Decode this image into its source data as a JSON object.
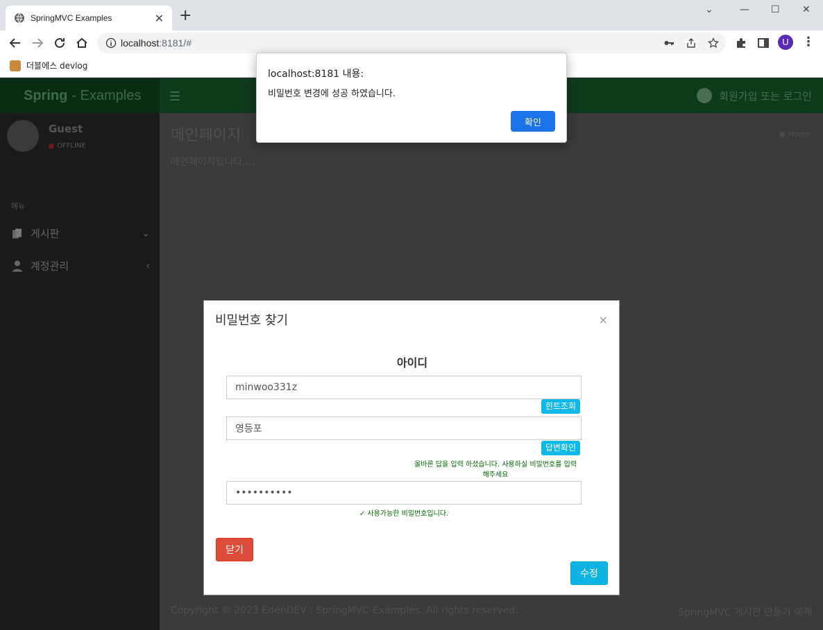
{
  "browser": {
    "tab_title": "SpringMVC Examples",
    "tab_close": "✕",
    "new_tab": "+",
    "url_host": "localhost",
    "url_rest": ":8181/#",
    "bookmark_label": "더블에스 devlog",
    "profile_initial": "U",
    "window_controls": {
      "chevron": "⌄",
      "minimize": "—",
      "maximize": "☐",
      "close": "✕"
    }
  },
  "page": {
    "logo_bold": "Spring",
    "logo_rest": "- Examples",
    "header_login": "회원가입 또는 로그인",
    "user_name": "Guest",
    "user_status": "OFFLINE",
    "menu_header": "메뉴",
    "menu_items": [
      {
        "label": "게시판",
        "arrow": "⌄"
      },
      {
        "label": "계정관리",
        "arrow": "‹"
      }
    ],
    "content_title": "메인페이지",
    "content_sub": "메인페이지입니다....",
    "breadcrumb": "Home",
    "footer_left": "Copyright © 2023 EdenDEV : SpringMVC-Examples. All rights reserved.",
    "footer_right": "SpringMVC 게시판 만들기 예제"
  },
  "modal": {
    "title": "비밀번호 찾기",
    "close_x": "×",
    "id_label": "아이디",
    "id_value": "minwoo331z",
    "hint_button": "힌트조회",
    "answer_value": "영등포",
    "answer_button": "답변확인",
    "answer_message": "올바른 답을 입력 하셨습니다. 사용하실 비밀번호를 입력해주세요",
    "password_value": "••••••••••",
    "password_message": "✓ 사용가능한 비밀번호입니다.",
    "close_button": "닫기",
    "edit_button": "수정"
  },
  "alert": {
    "title": "localhost:8181 내용:",
    "body": "비밀번호 변경에 성공 하였습니다.",
    "ok_button": "확인"
  }
}
